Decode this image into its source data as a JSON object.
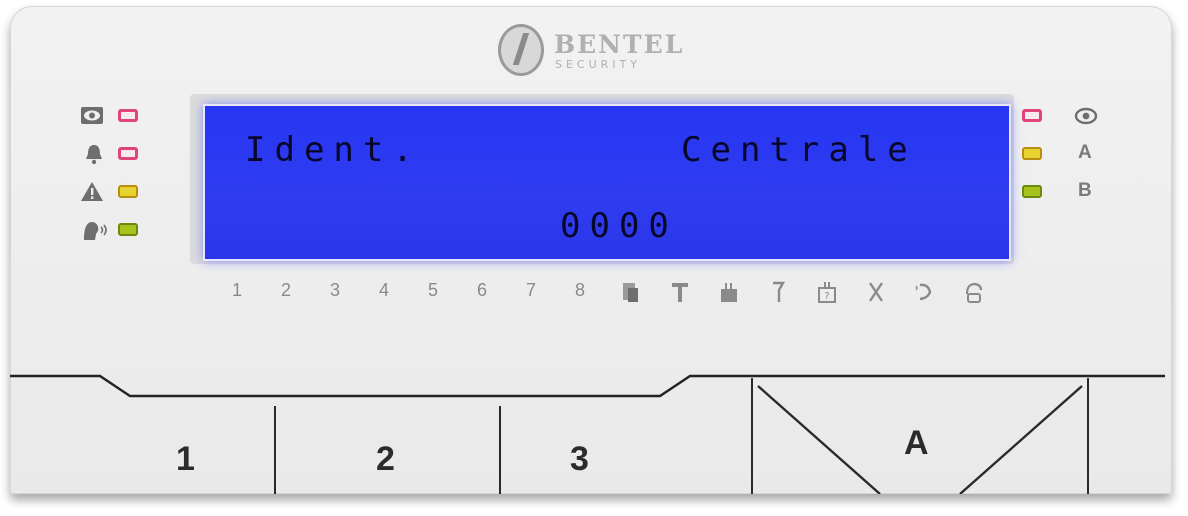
{
  "brand": {
    "name": "BENTEL",
    "subtitle": "SECURITY"
  },
  "display": {
    "line1_left": "Ident.",
    "line1_right": "Centrale",
    "line2": "0000"
  },
  "left_indicators": [
    {
      "icon": "eye-icon",
      "led_color": "red"
    },
    {
      "icon": "bell-icon",
      "led_color": "red"
    },
    {
      "icon": "warning-icon",
      "led_color": "yellow"
    },
    {
      "icon": "voice-icon",
      "led_color": "green"
    }
  ],
  "right_indicators": [
    {
      "led_color": "red",
      "label_icon": "eye-icon"
    },
    {
      "led_color": "yellow",
      "label": "A"
    },
    {
      "led_color": "green",
      "label": "B"
    }
  ],
  "zones": [
    "1",
    "2",
    "3",
    "4",
    "5",
    "6",
    "7",
    "8"
  ],
  "status_icons": [
    "panel-icon",
    "tamper-icon",
    "battery-icon",
    "fuse-icon",
    "fault-icon",
    "tools-icon",
    "phone-icon",
    "phone-line-icon"
  ],
  "keys": {
    "k1": "1",
    "k2": "2",
    "k3": "3",
    "kA": "A"
  },
  "colors": {
    "lcd_bg": "#2f3cf0",
    "lcd_text": "#07072a",
    "led_red": "#e0447a",
    "led_yellow": "#e8d230",
    "led_green": "#a8c41c"
  }
}
